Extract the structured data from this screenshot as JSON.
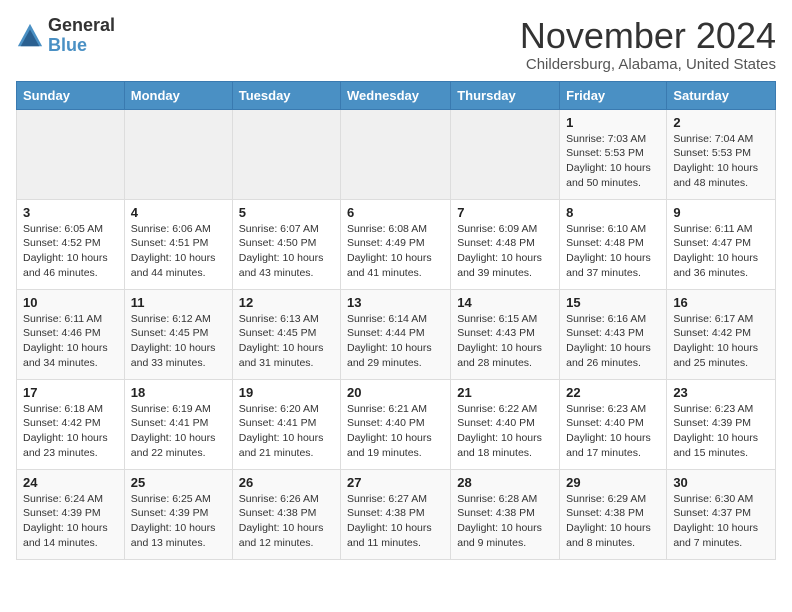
{
  "logo": {
    "general": "General",
    "blue": "Blue"
  },
  "header": {
    "title": "November 2024",
    "location": "Childersburg, Alabama, United States"
  },
  "days_of_week": [
    "Sunday",
    "Monday",
    "Tuesday",
    "Wednesday",
    "Thursday",
    "Friday",
    "Saturday"
  ],
  "weeks": [
    [
      {
        "day": "",
        "info": ""
      },
      {
        "day": "",
        "info": ""
      },
      {
        "day": "",
        "info": ""
      },
      {
        "day": "",
        "info": ""
      },
      {
        "day": "",
        "info": ""
      },
      {
        "day": "1",
        "info": "Sunrise: 7:03 AM\nSunset: 5:53 PM\nDaylight: 10 hours and 50 minutes."
      },
      {
        "day": "2",
        "info": "Sunrise: 7:04 AM\nSunset: 5:53 PM\nDaylight: 10 hours and 48 minutes."
      }
    ],
    [
      {
        "day": "3",
        "info": "Sunrise: 6:05 AM\nSunset: 4:52 PM\nDaylight: 10 hours and 46 minutes."
      },
      {
        "day": "4",
        "info": "Sunrise: 6:06 AM\nSunset: 4:51 PM\nDaylight: 10 hours and 44 minutes."
      },
      {
        "day": "5",
        "info": "Sunrise: 6:07 AM\nSunset: 4:50 PM\nDaylight: 10 hours and 43 minutes."
      },
      {
        "day": "6",
        "info": "Sunrise: 6:08 AM\nSunset: 4:49 PM\nDaylight: 10 hours and 41 minutes."
      },
      {
        "day": "7",
        "info": "Sunrise: 6:09 AM\nSunset: 4:48 PM\nDaylight: 10 hours and 39 minutes."
      },
      {
        "day": "8",
        "info": "Sunrise: 6:10 AM\nSunset: 4:48 PM\nDaylight: 10 hours and 37 minutes."
      },
      {
        "day": "9",
        "info": "Sunrise: 6:11 AM\nSunset: 4:47 PM\nDaylight: 10 hours and 36 minutes."
      }
    ],
    [
      {
        "day": "10",
        "info": "Sunrise: 6:11 AM\nSunset: 4:46 PM\nDaylight: 10 hours and 34 minutes."
      },
      {
        "day": "11",
        "info": "Sunrise: 6:12 AM\nSunset: 4:45 PM\nDaylight: 10 hours and 33 minutes."
      },
      {
        "day": "12",
        "info": "Sunrise: 6:13 AM\nSunset: 4:45 PM\nDaylight: 10 hours and 31 minutes."
      },
      {
        "day": "13",
        "info": "Sunrise: 6:14 AM\nSunset: 4:44 PM\nDaylight: 10 hours and 29 minutes."
      },
      {
        "day": "14",
        "info": "Sunrise: 6:15 AM\nSunset: 4:43 PM\nDaylight: 10 hours and 28 minutes."
      },
      {
        "day": "15",
        "info": "Sunrise: 6:16 AM\nSunset: 4:43 PM\nDaylight: 10 hours and 26 minutes."
      },
      {
        "day": "16",
        "info": "Sunrise: 6:17 AM\nSunset: 4:42 PM\nDaylight: 10 hours and 25 minutes."
      }
    ],
    [
      {
        "day": "17",
        "info": "Sunrise: 6:18 AM\nSunset: 4:42 PM\nDaylight: 10 hours and 23 minutes."
      },
      {
        "day": "18",
        "info": "Sunrise: 6:19 AM\nSunset: 4:41 PM\nDaylight: 10 hours and 22 minutes."
      },
      {
        "day": "19",
        "info": "Sunrise: 6:20 AM\nSunset: 4:41 PM\nDaylight: 10 hours and 21 minutes."
      },
      {
        "day": "20",
        "info": "Sunrise: 6:21 AM\nSunset: 4:40 PM\nDaylight: 10 hours and 19 minutes."
      },
      {
        "day": "21",
        "info": "Sunrise: 6:22 AM\nSunset: 4:40 PM\nDaylight: 10 hours and 18 minutes."
      },
      {
        "day": "22",
        "info": "Sunrise: 6:23 AM\nSunset: 4:40 PM\nDaylight: 10 hours and 17 minutes."
      },
      {
        "day": "23",
        "info": "Sunrise: 6:23 AM\nSunset: 4:39 PM\nDaylight: 10 hours and 15 minutes."
      }
    ],
    [
      {
        "day": "24",
        "info": "Sunrise: 6:24 AM\nSunset: 4:39 PM\nDaylight: 10 hours and 14 minutes."
      },
      {
        "day": "25",
        "info": "Sunrise: 6:25 AM\nSunset: 4:39 PM\nDaylight: 10 hours and 13 minutes."
      },
      {
        "day": "26",
        "info": "Sunrise: 6:26 AM\nSunset: 4:38 PM\nDaylight: 10 hours and 12 minutes."
      },
      {
        "day": "27",
        "info": "Sunrise: 6:27 AM\nSunset: 4:38 PM\nDaylight: 10 hours and 11 minutes."
      },
      {
        "day": "28",
        "info": "Sunrise: 6:28 AM\nSunset: 4:38 PM\nDaylight: 10 hours and 9 minutes."
      },
      {
        "day": "29",
        "info": "Sunrise: 6:29 AM\nSunset: 4:38 PM\nDaylight: 10 hours and 8 minutes."
      },
      {
        "day": "30",
        "info": "Sunrise: 6:30 AM\nSunset: 4:37 PM\nDaylight: 10 hours and 7 minutes."
      }
    ]
  ],
  "colors": {
    "header_bg": "#4a90c4",
    "accent": "#4a90c4"
  }
}
